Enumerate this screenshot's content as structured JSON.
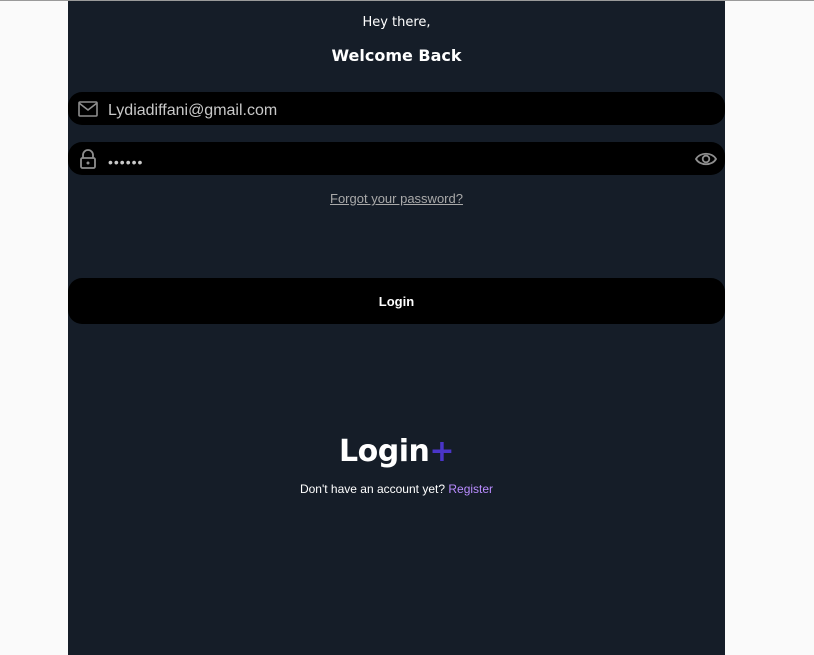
{
  "header": {
    "greeting": "Hey there,",
    "title": "Welcome Back"
  },
  "form": {
    "email": {
      "value": "Lydiadiffani@gmail.com",
      "icon": "mail-icon"
    },
    "password": {
      "value": "••••••",
      "icon": "lock-icon",
      "toggle_icon": "eye-icon"
    },
    "forgot_link": "Forgot your password?",
    "login_button": "Login"
  },
  "brand": {
    "name": "Login",
    "symbol": "+",
    "accent_color": "#4a35c9"
  },
  "footer": {
    "prompt": "Don't have an account yet?",
    "register_link": "Register",
    "link_color": "#b98cff"
  },
  "colors": {
    "panel_bg": "#151d28",
    "field_bg": "#000000",
    "page_bg": "#fafafa"
  }
}
